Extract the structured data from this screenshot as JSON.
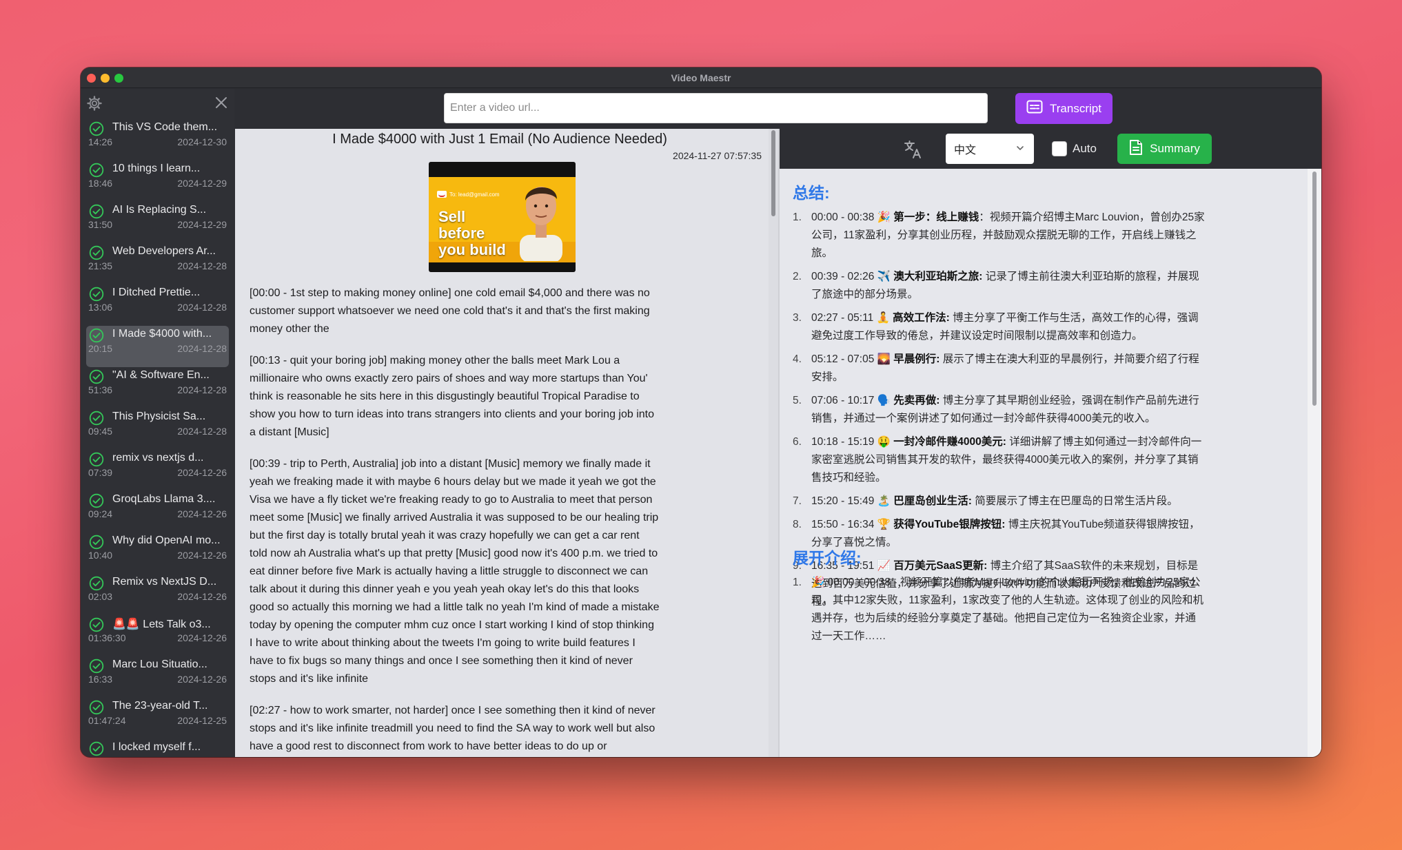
{
  "window": {
    "title": "Video Maestr"
  },
  "toolbar": {
    "url_placeholder": "Enter a video url...",
    "transcript_label": "Transcript"
  },
  "sidebar": {
    "items": [
      {
        "title": "This VS Code them...",
        "duration": "14:26",
        "date": "2024-12-30"
      },
      {
        "title": "10 things I learn...",
        "duration": "18:46",
        "date": "2024-12-29"
      },
      {
        "title": "AI Is Replacing S...",
        "duration": "31:50",
        "date": "2024-12-29"
      },
      {
        "title": "Web Developers Ar...",
        "duration": "21:35",
        "date": "2024-12-28"
      },
      {
        "title": "I Ditched Prettie...",
        "duration": "13:06",
        "date": "2024-12-28"
      },
      {
        "title": "I Made $4000 with...",
        "duration": "20:15",
        "date": "2024-12-28"
      },
      {
        "title": "\"AI & Software En...",
        "duration": "51:36",
        "date": "2024-12-28"
      },
      {
        "title": "This Physicist Sa...",
        "duration": "09:45",
        "date": "2024-12-28"
      },
      {
        "title": "remix vs nextjs d...",
        "duration": "07:39",
        "date": "2024-12-26"
      },
      {
        "title": "GroqLabs Llama 3....",
        "duration": "09:24",
        "date": "2024-12-26"
      },
      {
        "title": "Why did OpenAI mo...",
        "duration": "10:40",
        "date": "2024-12-26"
      },
      {
        "title": "Remix vs NextJS D...",
        "duration": "02:03",
        "date": "2024-12-26"
      },
      {
        "title": "🚨🚨 Lets Talk o3...",
        "duration": "01:36:30",
        "date": "2024-12-26"
      },
      {
        "title": "Marc Lou Situatio...",
        "duration": "16:33",
        "date": "2024-12-26"
      },
      {
        "title": "The 23-year-old T...",
        "duration": "01:47:24",
        "date": "2024-12-25"
      },
      {
        "title": "I locked myself f...",
        "duration": "",
        "date": ""
      }
    ]
  },
  "transcript": {
    "title": "I Made $4000 with Just 1 Email (No Audience Needed)",
    "date": "2024-11-27 07:57:35",
    "thumbnail": {
      "email": "To: lead@gmail.com",
      "text": "Sell before you build"
    },
    "paragraphs": [
      "[00:00 - 1st step to making money online] one cold email $4,000 and there was no customer support whatsoever we need one cold that's it and that's the first making money other the",
      "[00:13 - quit your boring job] making money other the balls meet Mark Lou a millionaire who owns exactly zero pairs of shoes and way more startups than You' think is reasonable he sits here in this disgustingly beautiful Tropical Paradise to show you how to turn ideas into trans strangers into clients and your boring job into a distant [Music]",
      "[00:39 - trip to Perth, Australia] job into a distant [Music] memory we finally made it yeah we freaking made it with maybe 6 hours delay but we made it yeah we got the Visa we have a fly ticket we're freaking ready to go to Australia to meet that person meet some [Music] we finally arrived Australia it was supposed to be our healing trip but the first day is totally brutal yeah it was crazy hopefully we can get a car rent told now ah Australia what's up that pretty [Music] good now it's 400 p.m. we tried to eat dinner before five Mark is actually having a little struggle to disconnect we can talk about it during this dinner yeah e you yeah yeah okay let's do this that looks good so actually this morning we had a little talk no yeah I'm kind of made a mistake today by opening the computer mhm cuz once I start working I kind of stop thinking I have to write about thinking about the tweets I'm going to write build features I have to fix bugs so many things and once I see something then it kind of never stops and it's like infinite",
      "[02:27 - how to work smarter, not harder] once I see something then it kind of never stops and it's like infinite treadmill you need to find the SA way to work well but also have a good rest to disconnect from work to have better ideas to do up or"
    ]
  },
  "summary_bar": {
    "language": "中文",
    "auto_label": "Auto",
    "summary_label": "Summary"
  },
  "summary": {
    "heading": "总结:",
    "items": [
      {
        "num": "1.",
        "time": "00:00 - 00:38 🎉 ",
        "bold": "第一步：线上赚钱",
        "text": "：视频开篇介绍博主Marc Louvion，曾创办25家公司，11家盈利，分享其创业历程，并鼓励观众摆脱无聊的工作，开启线上赚钱之旅。"
      },
      {
        "num": "2.",
        "time": "00:39 - 02:26 ✈️ ",
        "bold": "澳大利亚珀斯之旅:",
        "text": " 记录了博主前往澳大利亚珀斯的旅程，并展现了旅途中的部分场景。"
      },
      {
        "num": "3.",
        "time": "02:27 - 05:11 🧘 ",
        "bold": "高效工作法:",
        "text": " 博主分享了平衡工作与生活，高效工作的心得，强调避免过度工作导致的倦怠，并建议设定时间限制以提高效率和创造力。"
      },
      {
        "num": "4.",
        "time": "05:12 - 07:05 🌄 ",
        "bold": "早晨例行:",
        "text": " 展示了博主在澳大利亚的早晨例行，并简要介绍了行程安排。"
      },
      {
        "num": "5.",
        "time": "07:06 - 10:17 🗣️ ",
        "bold": "先卖再做:",
        "text": " 博主分享了其早期创业经验，强调在制作产品前先进行销售，并通过一个案例讲述了如何通过一封冷邮件获得4000美元的收入。"
      },
      {
        "num": "6.",
        "time": "10:18 - 15:19 🤑 ",
        "bold": "一封冷邮件赚4000美元:",
        "text": " 详细讲解了博主如何通过一封冷邮件向一家密室逃脱公司销售其开发的软件，最终获得4000美元收入的案例，并分享了其销售技巧和经验。"
      },
      {
        "num": "7.",
        "time": "15:20 - 15:49 🏝️ ",
        "bold": "巴厘岛创业生活:",
        "text": " 简要展示了博主在巴厘岛的日常生活片段。"
      },
      {
        "num": "8.",
        "time": "15:50 - 16:34 🏆 ",
        "bold": "获得YouTube银牌按钮:",
        "text": " 博主庆祝其YouTube频道获得银牌按钮，分享了喜悦之情。"
      },
      {
        "num": "9.",
        "time": "16:35 - 19:51 📈 ",
        "bold": "百万美元SaaS更新:",
        "text": " 博主介绍了其SaaS软件的未来规划，目标是达到百万美元估值，并分享了近期为提升软件功能而收集用户反馈和改进产品的过程。"
      }
    ],
    "heading2": "展开介绍:",
    "items2": [
      {
        "num": "1.",
        "text": "🎉 00:00 - 00:38 - 视频开篇以作者Marc Louvion的个人经历开场，他曾创办25家公司，其中12家失败，11家盈利，1家改变了他的人生轨迹。这体现了创业的风险和机遇并存，也为后续的经验分享奠定了基础。他把自己定位为一名独资企业家，并通过一天工作……"
      }
    ]
  },
  "colors": {
    "accent_purple": "#9a3ff0",
    "accent_green": "#27b24a",
    "heading_blue": "#2f78e8",
    "check_green": "#34c759"
  }
}
